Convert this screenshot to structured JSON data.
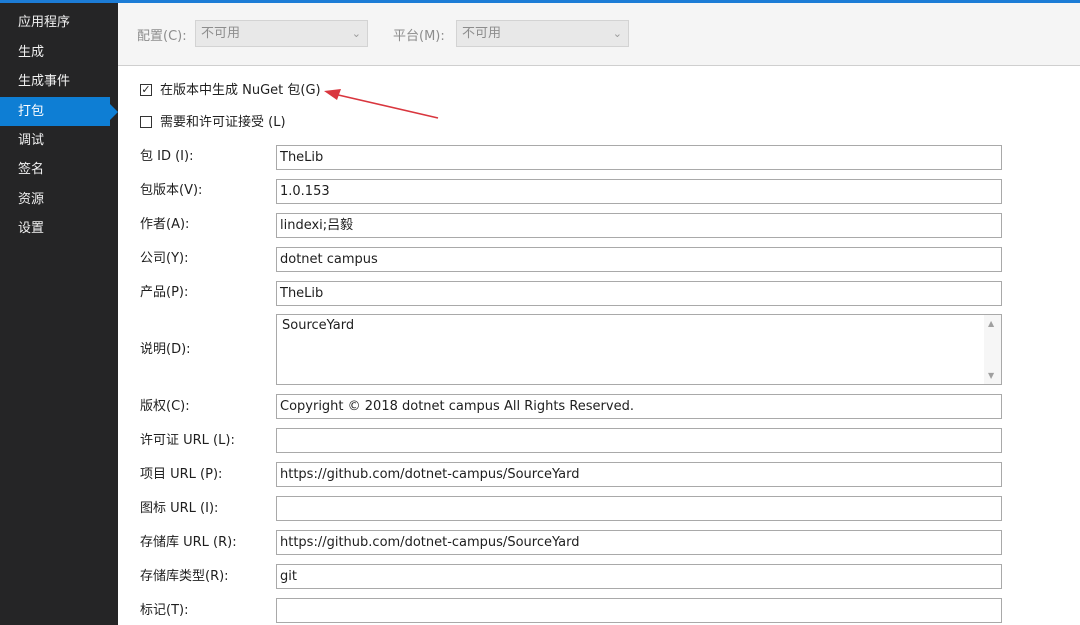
{
  "sidebar": {
    "items": [
      {
        "label": "应用程序"
      },
      {
        "label": "生成"
      },
      {
        "label": "生成事件"
      },
      {
        "label": "打包"
      },
      {
        "label": "调试"
      },
      {
        "label": "签名"
      },
      {
        "label": "资源"
      },
      {
        "label": "设置"
      }
    ],
    "active_index": 3
  },
  "toolbar": {
    "config_label": "配置(C):",
    "config_value": "不可用",
    "platform_label": "平台(M):",
    "platform_value": "不可用"
  },
  "options": {
    "generate_nuget": {
      "label": "在版本中生成 NuGet 包(G)",
      "checked": true
    },
    "require_license": {
      "label": "需要和许可证接受 (L)",
      "checked": false
    }
  },
  "fields": {
    "package_id": {
      "label": "包 ID (I):",
      "value": "TheLib"
    },
    "package_version": {
      "label": "包版本(V):",
      "value": "1.0.153"
    },
    "authors": {
      "label": "作者(A):",
      "value": "lindexi;吕毅"
    },
    "company": {
      "label": "公司(Y):",
      "value": "dotnet campus"
    },
    "product": {
      "label": "产品(P):",
      "value": "TheLib"
    },
    "description": {
      "label": "说明(D):",
      "value": "SourceYard"
    },
    "copyright": {
      "label": "版权(C):",
      "value": "Copyright © 2018 dotnet campus All Rights Reserved."
    },
    "license_url": {
      "label": "许可证 URL (L):",
      "value": ""
    },
    "project_url": {
      "label": "项目 URL (P):",
      "value": "https://github.com/dotnet-campus/SourceYard"
    },
    "icon_url": {
      "label": "图标 URL (I):",
      "value": ""
    },
    "repository_url": {
      "label": "存储库 URL (R):",
      "value": "https://github.com/dotnet-campus/SourceYard"
    },
    "repository_type": {
      "label": "存储库类型(R):",
      "value": "git"
    },
    "tags": {
      "label": "标记(T):",
      "value": ""
    }
  },
  "colors": {
    "sidebar_bg": "#252526",
    "active_item": "#0e7ed4",
    "annotation_arrow": "#d9363e"
  }
}
